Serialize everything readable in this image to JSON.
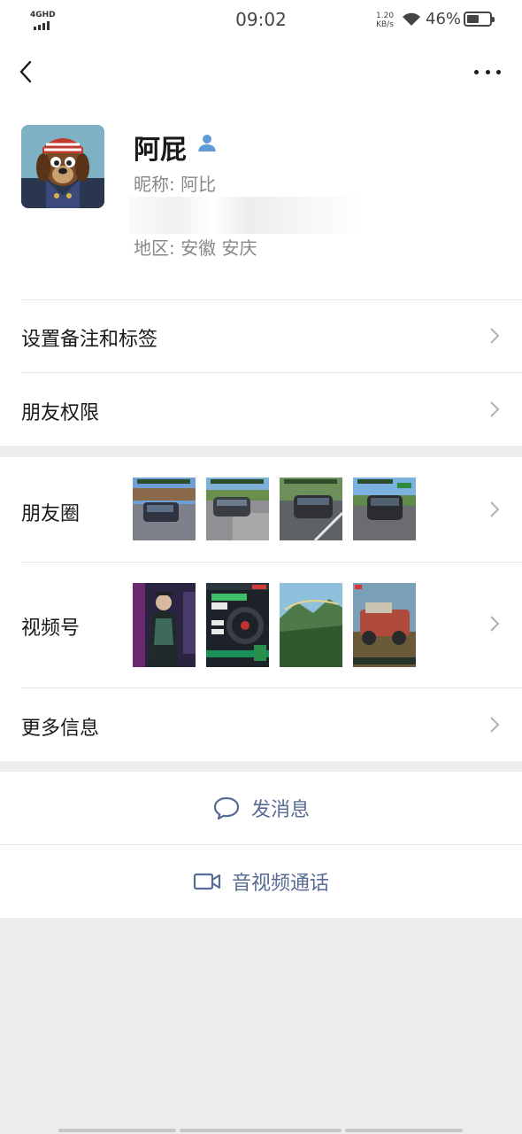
{
  "status_bar": {
    "network": "4GHD",
    "time": "09:02",
    "speed_value": "1.20",
    "speed_unit": "KB/s",
    "battery_percent": "46%",
    "battery_level": 0.46
  },
  "navbar": {
    "back_icon": "chevron-left-icon",
    "more_icon": "more-dots-icon"
  },
  "profile": {
    "name": "阿屁",
    "nickname": "昵称:  阿比",
    "region": "地区:  安徽  安庆",
    "badge_icon": "person-icon"
  },
  "rows": {
    "remark_tags": "设置备注和标签",
    "friend_permissions": "朋友权限",
    "moments": "朋友圈",
    "channels": "视频号",
    "more_info": "更多信息"
  },
  "actions": {
    "send_message": "发消息",
    "av_call": "音视频通话",
    "message_icon": "chat-bubble-icon",
    "call_icon": "video-camera-icon"
  },
  "colors": {
    "link_blue": "#576b95",
    "background": "#ededed"
  }
}
